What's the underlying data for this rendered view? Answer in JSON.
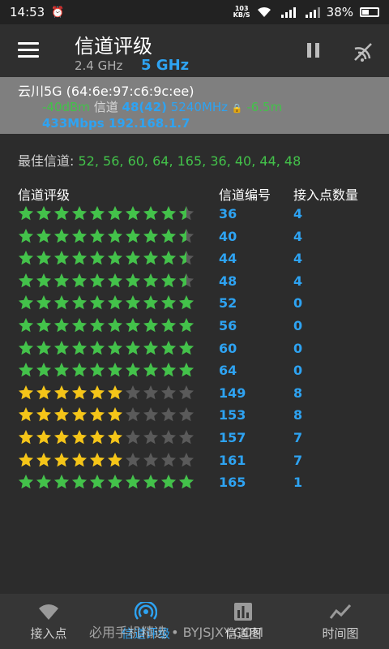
{
  "status": {
    "time": "14:53",
    "speed_top": "103",
    "speed_unit": "KB/S",
    "battery": "38%"
  },
  "header": {
    "title": "信道评级",
    "band_24": "2.4 GHz",
    "band_5": "5 GHz"
  },
  "connected": {
    "ssid": "云川5G (64:6e:97:c6:9c:ee)",
    "signal": "-40dBm",
    "channel_label": "信道",
    "channel": "48(42)",
    "freq": "5240MHz",
    "lock": "🔒",
    "extra": "-6.5m",
    "rate": "433Mbps",
    "ip": "192.168.1.7"
  },
  "best": {
    "label": "最佳信道:",
    "channels": "52, 56, 60, 64, 165, 36, 40, 44, 48"
  },
  "table": {
    "col_rating": "信道评级",
    "col_channel": "信道编号",
    "col_ap": "接入点数量",
    "rows": [
      {
        "channel": "36",
        "ap": "4",
        "rating": 9.5,
        "color": "#43c24a"
      },
      {
        "channel": "40",
        "ap": "4",
        "rating": 9.5,
        "color": "#43c24a"
      },
      {
        "channel": "44",
        "ap": "4",
        "rating": 9.5,
        "color": "#43c24a"
      },
      {
        "channel": "48",
        "ap": "4",
        "rating": 9.5,
        "color": "#43c24a"
      },
      {
        "channel": "52",
        "ap": "0",
        "rating": 10,
        "color": "#43c24a"
      },
      {
        "channel": "56",
        "ap": "0",
        "rating": 10,
        "color": "#43c24a"
      },
      {
        "channel": "60",
        "ap": "0",
        "rating": 10,
        "color": "#43c24a"
      },
      {
        "channel": "64",
        "ap": "0",
        "rating": 10,
        "color": "#43c24a"
      },
      {
        "channel": "149",
        "ap": "8",
        "rating": 6,
        "color": "#f5c518"
      },
      {
        "channel": "153",
        "ap": "8",
        "rating": 6,
        "color": "#f5c518"
      },
      {
        "channel": "157",
        "ap": "7",
        "rating": 6,
        "color": "#f5c518"
      },
      {
        "channel": "161",
        "ap": "7",
        "rating": 6,
        "color": "#f5c518"
      },
      {
        "channel": "165",
        "ap": "1",
        "rating": 10,
        "color": "#43c24a"
      }
    ]
  },
  "nav": {
    "items": [
      {
        "label": "接入点",
        "icon": "wifi-signal-icon"
      },
      {
        "label": "信道评级",
        "icon": "radar-icon"
      },
      {
        "label": "信道图",
        "icon": "bar-chart-icon"
      },
      {
        "label": "时间图",
        "icon": "line-chart-icon"
      }
    ]
  },
  "watermark": "必用手机精选 • BYJSJXY.COM"
}
